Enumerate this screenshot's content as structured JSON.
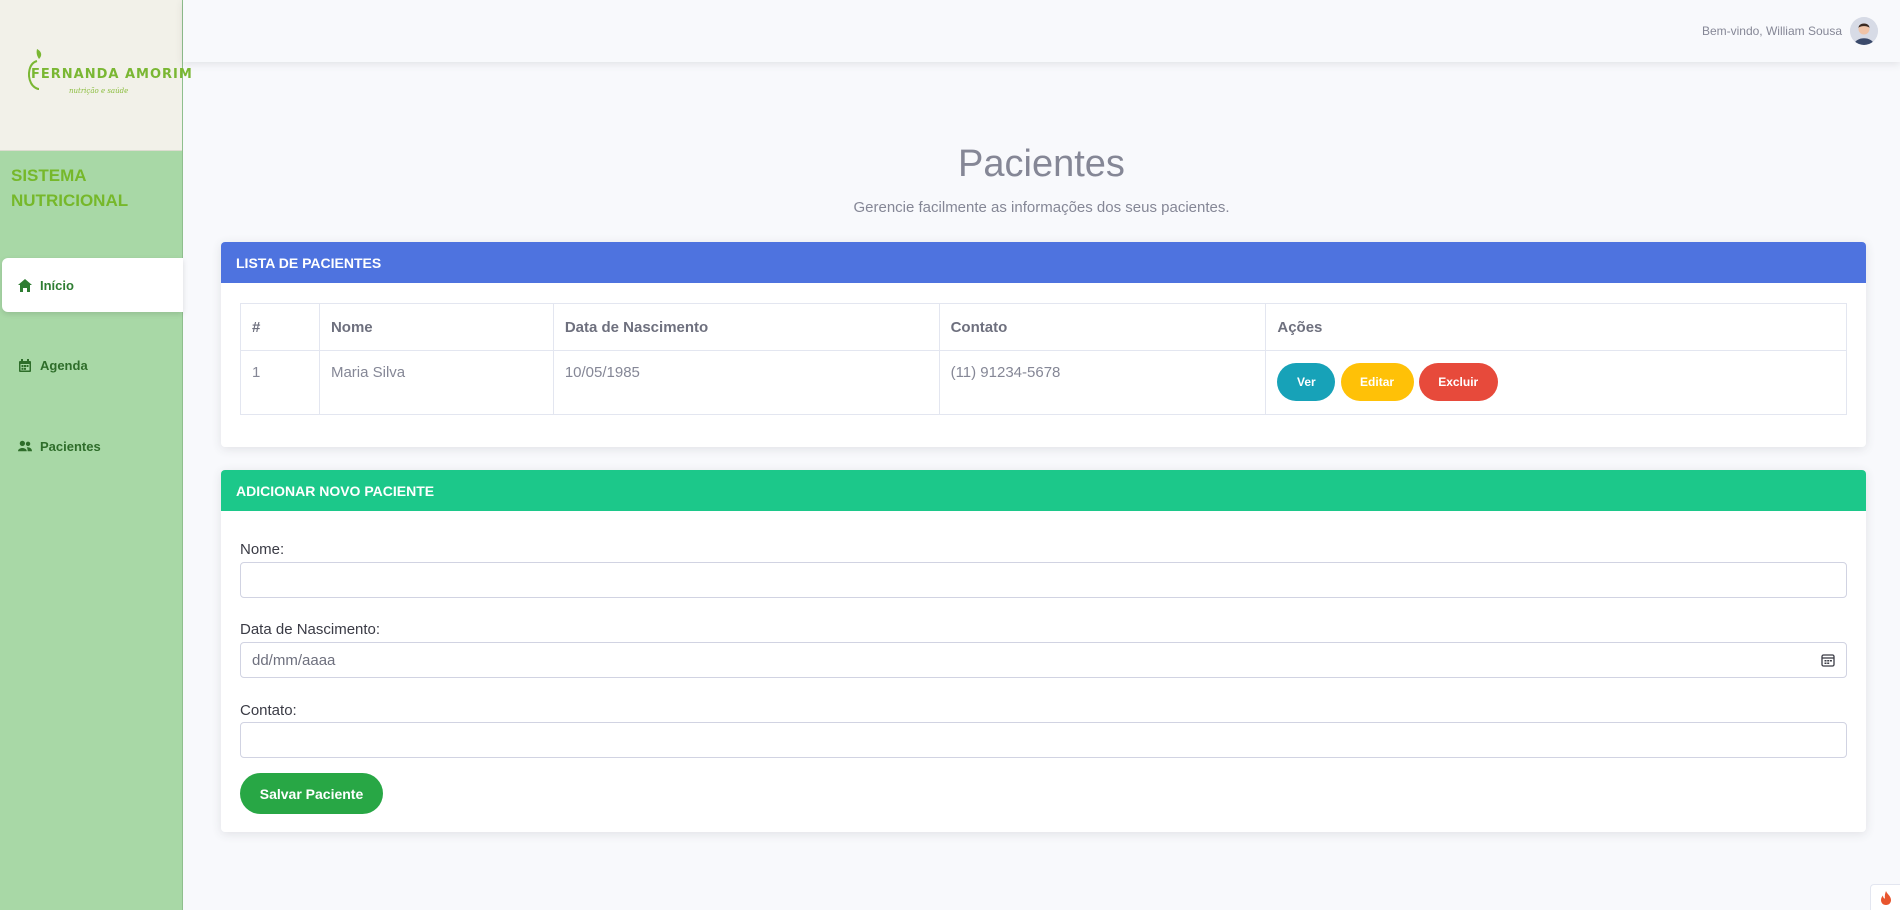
{
  "logo": {
    "brand": "FERNANDA AMORIM",
    "tagline": "nutrição e saúde"
  },
  "sidebar": {
    "title": "SISTEMA NUTRICIONAL",
    "items": [
      {
        "label": "Início",
        "icon": "home-icon",
        "active": true
      },
      {
        "label": "Agenda",
        "icon": "calendar-icon",
        "active": false
      },
      {
        "label": "Pacientes",
        "icon": "users-icon",
        "active": false
      }
    ]
  },
  "topbar": {
    "welcome": "Bem-vindo, William Sousa",
    "avatar": "user-avatar"
  },
  "page": {
    "title": "Pacientes",
    "subtitle": "Gerencie facilmente as informações dos seus pacientes."
  },
  "list_card": {
    "title": "LISTA DE PACIENTES",
    "columns": [
      "#",
      "Nome",
      "Data de Nascimento",
      "Contato",
      "Ações"
    ],
    "rows": [
      {
        "id": "1",
        "nome": "Maria Silva",
        "nascimento": "10/05/1985",
        "contato": "(11) 91234-5678"
      }
    ],
    "actions": {
      "ver": "Ver",
      "editar": "Editar",
      "excluir": "Excluir"
    }
  },
  "form_card": {
    "title": "ADICIONAR NOVO PACIENTE",
    "fields": {
      "nome": {
        "label": "Nome:",
        "value": ""
      },
      "nascimento": {
        "label": "Data de Nascimento:",
        "placeholder": "dd/mm/aaaa"
      },
      "contato": {
        "label": "Contato:",
        "value": ""
      }
    },
    "submit": "Salvar Paciente"
  },
  "colors": {
    "sidebar_bg": "#a8d8a6",
    "primary": "#4e73df",
    "success": "#1cc88a",
    "info": "#17a2b8",
    "warning": "#ffc107",
    "danger": "#e74a3b",
    "save": "#28a745"
  }
}
